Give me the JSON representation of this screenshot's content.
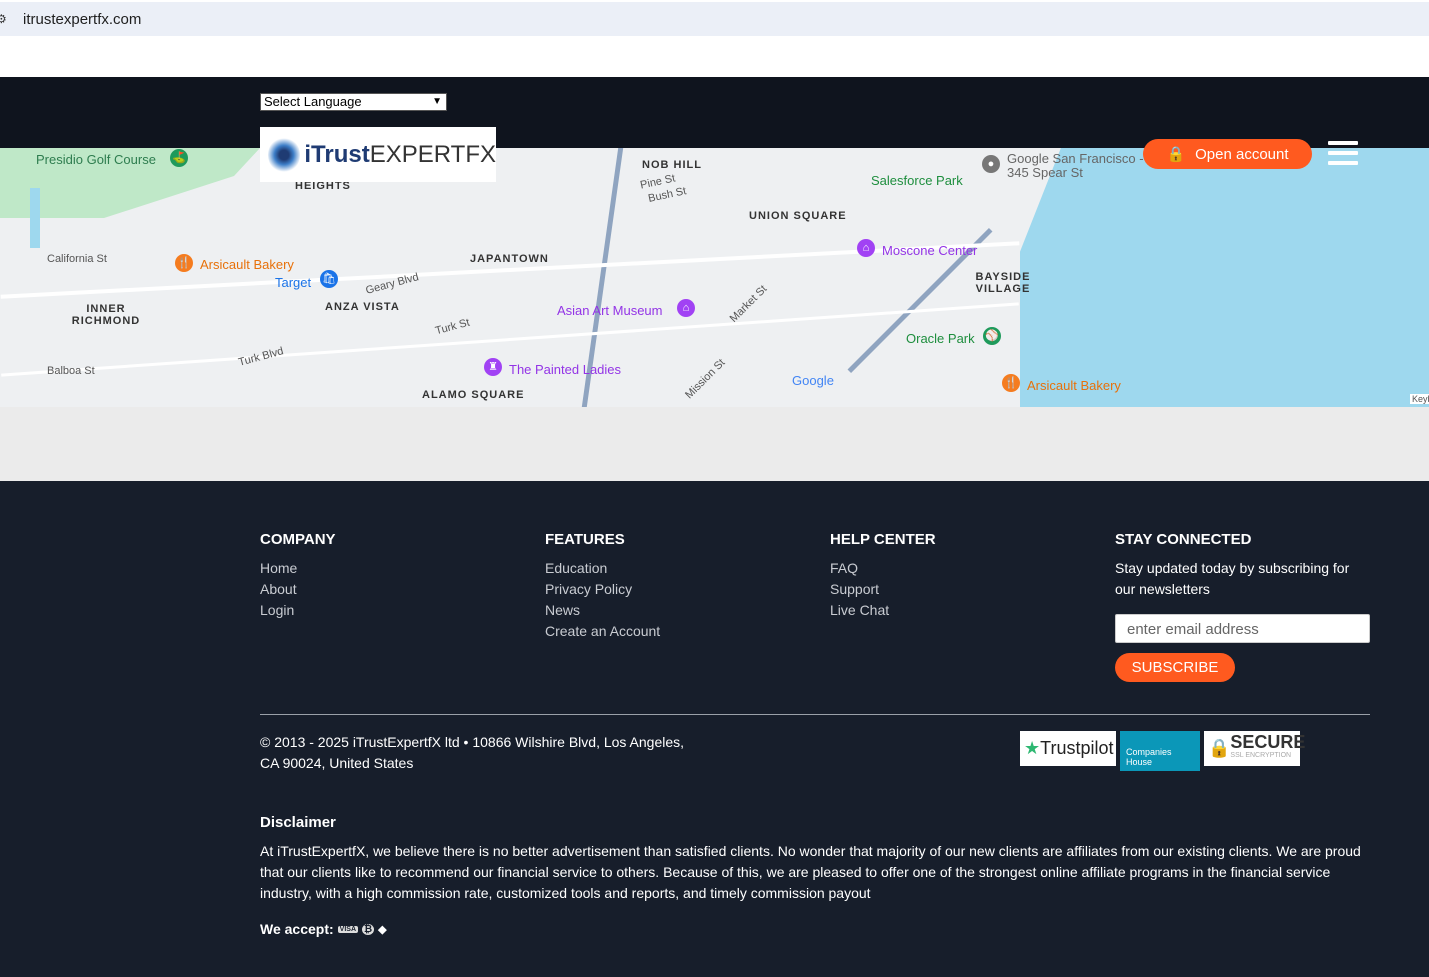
{
  "browser": {
    "url": "itrustexpertfx.com"
  },
  "header": {
    "language": "Select Language",
    "logo_a": "iTrust",
    "logo_b": "EXPERTFX",
    "open_account": "Open account"
  },
  "map": {
    "labels": [
      "Presidio Golf Course",
      "HEIGHTS",
      "California St",
      "Arsicault Bakery",
      "Target",
      "INNER RICHMOND",
      "ANZA VISTA",
      "Geary Blvd",
      "JAPANTOWN",
      "Asian Art Museum",
      "Turk St",
      "Turk Blvd",
      "Balboa St",
      "The Painted Ladies",
      "ALAMO SQUARE",
      "NOB HILL",
      "Pine St",
      "Bush St",
      "UNION SQUARE",
      "Salesforce Park",
      "Moscone Center",
      "Google San Francisco - 345 Spear St",
      "BAYSIDE VILLAGE",
      "Oracle Park",
      "Arsicault Bakery",
      "Mission St",
      "Market St",
      "Google",
      "Keyb"
    ]
  },
  "footer": {
    "company": {
      "title": "COMPANY",
      "links": [
        "Home",
        "About",
        "Login"
      ]
    },
    "features": {
      "title": "FEATURES",
      "links": [
        "Education",
        "Privacy Policy",
        "News",
        "Create an Account"
      ]
    },
    "help": {
      "title": "HELP CENTER",
      "links": [
        "FAQ",
        "Support",
        "Live Chat"
      ]
    },
    "stay": {
      "title": "STAY CONNECTED",
      "text": "Stay updated today by subscribing for our newsletters",
      "placeholder": "enter email address",
      "button": "SUBSCRIBE"
    },
    "copyright": "© 2013 - 2025 iTrustExpertfX ltd • 10866 Wilshire Blvd, Los Angeles, CA 90024, United States",
    "badges": [
      "Trustpilot",
      "Companies House",
      "SECURE",
      "SSL ENCRYPTION"
    ],
    "disclaimer_title": "Disclaimer",
    "disclaimer": "At iTrustExpertfX, we believe there is no better advertisement than satisfied clients. No wonder that majority of our new clients are affiliates from our existing clients. We are proud that our clients like to recommend our financial service to others. Because of this, we are pleased to offer one of the strongest online affiliate programs in the financial service industry, with a high commission rate, customized tools and reports, and timely commission payout",
    "we_accept": "We accept:",
    "payment": [
      "VISA",
      "₿",
      "◆"
    ]
  }
}
